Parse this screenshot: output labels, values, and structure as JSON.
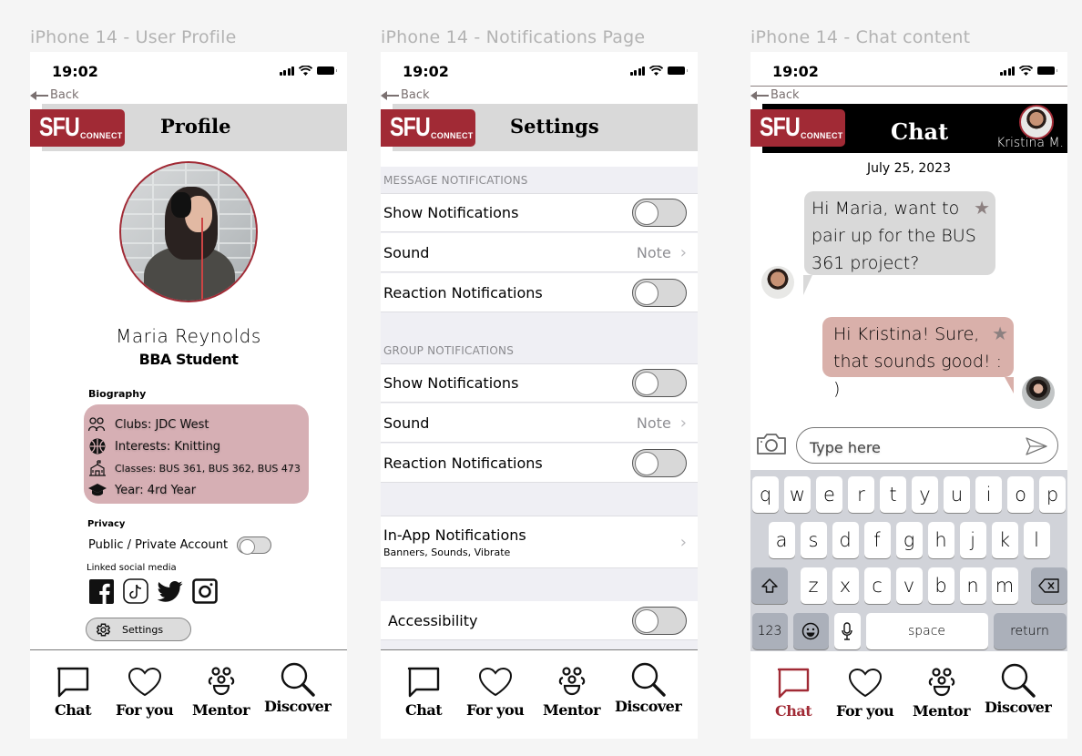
{
  "frames": [
    {
      "title": "iPhone 14 - User Profile"
    },
    {
      "title": "iPhone 14 - Notifications Page"
    },
    {
      "title": "iPhone 14 - Chat content"
    }
  ],
  "status": {
    "time": "19:02"
  },
  "back_label": "Back",
  "logo": {
    "main": "SFU",
    "sub": "CONNECT"
  },
  "colors": {
    "brand": "#a12a35",
    "bio_bg": "#d6afb4",
    "incoming_bubble": "#d9d9d9",
    "outgoing_bubble": "#d9b0aa"
  },
  "profile": {
    "title": "Profile",
    "name": "Maria Reynolds",
    "role": "BBA Student",
    "biography_label": "Biography",
    "bio": [
      {
        "icon": "people-icon",
        "label": "Clubs: JDC West"
      },
      {
        "icon": "basketball-icon",
        "label": "Interests: Knitting"
      },
      {
        "icon": "school-icon",
        "label": "Classes: BUS 361, BUS 362, BUS 473"
      },
      {
        "icon": "graduation-cap-icon",
        "label": "Year: 4rd Year"
      }
    ],
    "privacy_label": "Privacy",
    "privacy_toggle_label": "Public /  Private Account",
    "privacy_toggle_on": false,
    "linked_label": "Linked social media",
    "social": [
      "facebook",
      "tiktok",
      "twitter",
      "instagram"
    ],
    "settings_button": "Settings"
  },
  "settings": {
    "title": "Settings",
    "message_header": "MESSAGE NOTIFICATIONS",
    "group_header": "GROUP NOTIFICATIONS",
    "message_rows": [
      {
        "label": "Show Notifications",
        "type": "toggle",
        "on": false
      },
      {
        "label": "Sound",
        "type": "value",
        "value": "Note"
      },
      {
        "label": "Reaction Notifications",
        "type": "toggle",
        "on": false
      }
    ],
    "group_rows": [
      {
        "label": "Show Notifications",
        "type": "toggle",
        "on": false
      },
      {
        "label": "Sound",
        "type": "value",
        "value": "Note"
      },
      {
        "label": "Reaction Notifications",
        "type": "toggle",
        "on": false
      }
    ],
    "in_app": {
      "label": "In-App Notifications",
      "sub": "Banners, Sounds, Vibrate"
    },
    "accessibility": {
      "label": "Accessibility",
      "on": false
    }
  },
  "chat": {
    "title": "Chat",
    "contact_name": "Kristina M.",
    "date": "July 25, 2023",
    "messages": [
      {
        "from": "Kristina M.",
        "direction": "incoming",
        "text": "Hi  Maria, want to pair up for the  BUS 361 project?",
        "starred": true
      },
      {
        "from": "Maria Reynolds",
        "direction": "outgoing",
        "text": "Hi  Kristina! Sure, that sounds good! : )",
        "starred": true
      }
    ],
    "input_placeholder": "Type here",
    "keyboard": {
      "row1": [
        "q",
        "w",
        "e",
        "r",
        "t",
        "y",
        "u",
        "i",
        "o",
        "p"
      ],
      "row2": [
        "a",
        "s",
        "d",
        "f",
        "g",
        "h",
        "j",
        "k",
        "l"
      ],
      "row3": [
        "z",
        "x",
        "c",
        "v",
        "b",
        "n",
        "m"
      ],
      "num": "123",
      "space": "space",
      "return": "return"
    }
  },
  "tabbar": {
    "items": [
      {
        "label": "Chat",
        "icon": "chat-bubble-icon"
      },
      {
        "label": "For you",
        "icon": "heart-icon"
      },
      {
        "label": "Mentor",
        "icon": "mentor-group-icon"
      },
      {
        "label": "Discover",
        "icon": "search-icon"
      }
    ],
    "active_on_chat_screen": "Chat"
  }
}
